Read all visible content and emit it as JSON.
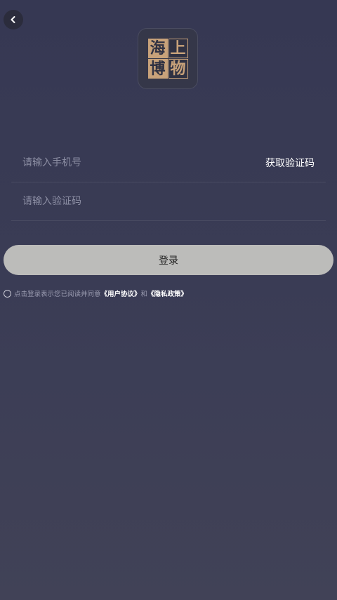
{
  "header": {
    "back_icon": "chevron-left-icon"
  },
  "logo": {
    "chars": [
      "海",
      "上",
      "博",
      "物"
    ],
    "accent_color": "#c8a27a"
  },
  "form": {
    "phone_placeholder": "请输入手机号",
    "get_code_label": "获取验证码",
    "code_placeholder": "请输入验证码"
  },
  "login": {
    "button_label": "登录"
  },
  "agreement": {
    "prefix": "点击登录表示您已阅读并同意",
    "user_agreement": "《用户协议》",
    "and": "和",
    "privacy_policy": "《隐私政策》"
  }
}
